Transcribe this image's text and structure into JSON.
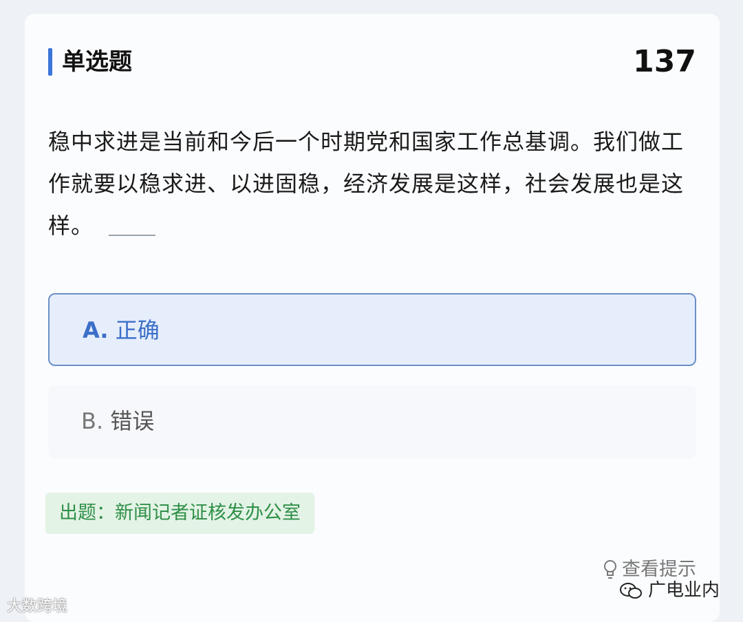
{
  "question": {
    "type_label": "单选题",
    "number": "137",
    "text": "稳中求进是当前和今后一个时期党和国家工作总基调。我们做工作就要以稳求进、以进固稳，经济发展是这样，社会发展也是这样。"
  },
  "options": [
    {
      "letter": "A.",
      "text": "正确",
      "selected": true
    },
    {
      "letter": "B.",
      "text": "错误",
      "selected": false
    }
  ],
  "source": "出题：新闻记者证核发办公室",
  "hint": {
    "label": "查看提示",
    "icon": "lightbulb-icon"
  },
  "watermarks": {
    "left": "大数跨境",
    "right": "广电业内",
    "right_icon": "wechat-icon"
  },
  "colors": {
    "accent": "#3b75d9",
    "selected_bg": "#e6eefc",
    "source_green": "#2f8f47"
  }
}
